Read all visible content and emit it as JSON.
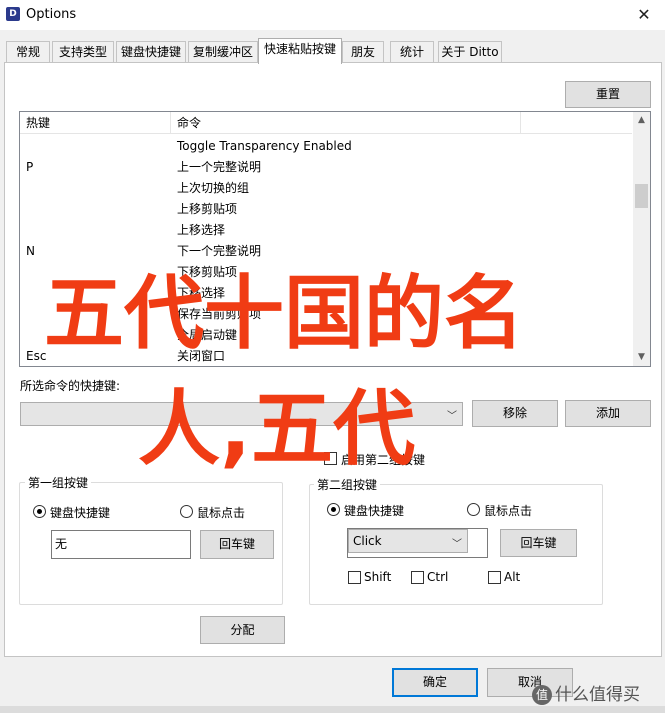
{
  "window": {
    "title": "Options",
    "close_glyph": "✕",
    "icon": "ditto-app-icon"
  },
  "tabs": [
    {
      "label": "常规",
      "active": false
    },
    {
      "label": "支持类型",
      "active": false
    },
    {
      "label": "键盘快捷键",
      "active": false
    },
    {
      "label": "复制缓冲区",
      "active": false
    },
    {
      "label": "快速粘贴按键",
      "active": true
    },
    {
      "label": "朋友",
      "active": false
    },
    {
      "label": "统计",
      "active": false
    },
    {
      "label": "关于 Ditto",
      "active": false
    }
  ],
  "reset_button": "重置",
  "shortcut_list": {
    "columns": [
      "热键",
      "命令"
    ],
    "rows": [
      {
        "key": "",
        "command": "Toggle Transparency Enabled"
      },
      {
        "key": "P",
        "command": "上一个完整说明"
      },
      {
        "key": "",
        "command": "上次切换的组"
      },
      {
        "key": "",
        "command": "上移剪贴项"
      },
      {
        "key": "",
        "command": "上移选择"
      },
      {
        "key": "N",
        "command": "下一个完整说明"
      },
      {
        "key": "",
        "command": "下移剪贴项"
      },
      {
        "key": "",
        "command": "下移选择"
      },
      {
        "key": "",
        "command": "保存当前剪贴项"
      },
      {
        "key": "",
        "command": "全局启动键"
      },
      {
        "key": "Esc",
        "command": "关闭窗口"
      }
    ]
  },
  "selected_shortcut_label": "所选命令的快捷键:",
  "remove_button": "移除",
  "add_button": "添加",
  "enable_second_key_label": "启用第二组按键",
  "group1": {
    "title": "第一组按键",
    "radio_keyboard": "键盘快捷键",
    "radio_mouse": "鼠标点击",
    "input_value": "无",
    "enter_button": "回车键"
  },
  "group2": {
    "title": "第二组按键",
    "radio_keyboard": "键盘快捷键",
    "radio_mouse": "鼠标点击",
    "combo_value": "Click",
    "enter_button": "回车键",
    "mod_shift": "Shift",
    "mod_ctrl": "Ctrl",
    "mod_alt": "Alt"
  },
  "assign_button": "分配",
  "ok_button": "确定",
  "cancel_button": "取消",
  "overlay": {
    "line1": "五代十国的名",
    "line2": "人,五代",
    "color": "#f03c14"
  },
  "watermark": {
    "glyph": "值",
    "text": "什么值得买"
  }
}
